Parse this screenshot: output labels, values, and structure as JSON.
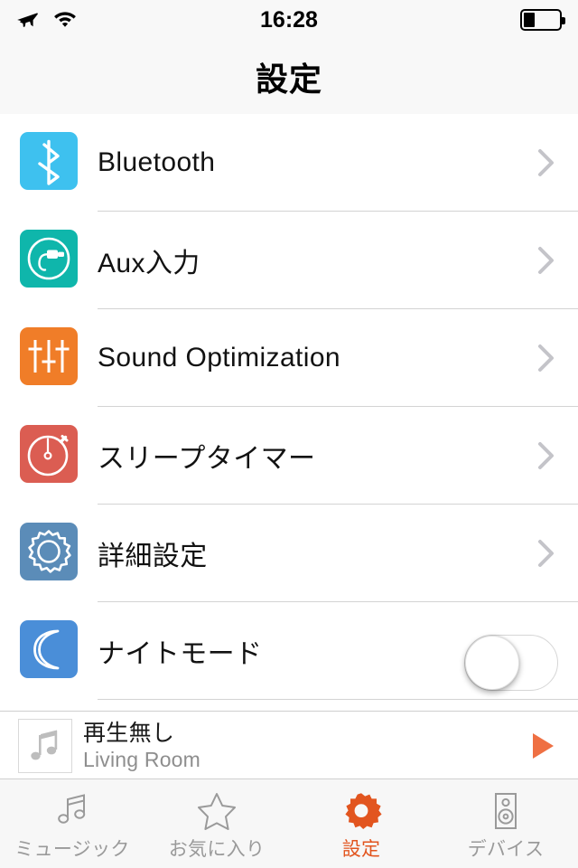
{
  "statusbar": {
    "airplane_icon": "airplane-icon",
    "wifi_icon": "wifi-icon",
    "time": "16:28",
    "battery_icon": "battery-icon",
    "battery_level_percent": 32
  },
  "navbar": {
    "title": "設定"
  },
  "colors": {
    "bluetooth_icon_bg": "#3ec1ef",
    "aux_icon_bg": "#0fb6ab",
    "sound_icon_bg": "#f07d28",
    "timer_icon_bg": "#db5d52",
    "advanced_icon_bg": "#5b8cb8",
    "night_icon_bg": "#4a8ed8",
    "accent": "#e2551f",
    "chevron": "#c4c4c9",
    "separator": "#d3d3d3",
    "header_bg": "#f8f8f8",
    "tabbar_bg": "#f7f7f7"
  },
  "list": {
    "rows": [
      {
        "label": "Bluetooth",
        "icon": "bluetooth-icon",
        "accessory": "chevron"
      },
      {
        "label": "Aux入力",
        "icon": "aux-input-icon",
        "accessory": "chevron"
      },
      {
        "label": "Sound Optimization",
        "icon": "equalizer-icon",
        "accessory": "chevron"
      },
      {
        "label": "スリープタイマー",
        "icon": "stopwatch-icon",
        "accessory": "chevron"
      },
      {
        "label": "詳細設定",
        "icon": "gear-icon",
        "accessory": "chevron"
      },
      {
        "label": "ナイトモード",
        "icon": "moon-icon",
        "accessory": "toggle",
        "toggle_on": false
      }
    ]
  },
  "nowplaying": {
    "artwork_icon": "music-note-icon",
    "title": "再生無し",
    "subtitle": "Living Room",
    "play_icon": "play-icon"
  },
  "tabbar": {
    "tabs": [
      {
        "label": "ミュージック",
        "icon": "music-note-icon",
        "active": false
      },
      {
        "label": "お気に入り",
        "icon": "star-icon",
        "active": false
      },
      {
        "label": "設定",
        "icon": "gear-icon",
        "active": true
      },
      {
        "label": "デバイス",
        "icon": "speaker-icon",
        "active": false
      }
    ]
  }
}
